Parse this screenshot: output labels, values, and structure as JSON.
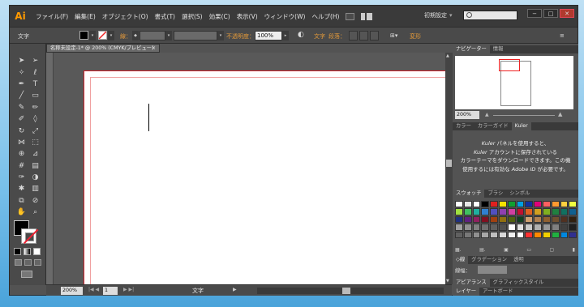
{
  "app": {
    "logo": "Ai"
  },
  "menu": [
    "ファイル(F)",
    "編集(E)",
    "オブジェクト(O)",
    "書式(T)",
    "選択(S)",
    "効果(C)",
    "表示(V)",
    "ウィンドウ(W)",
    "ヘルプ(H)"
  ],
  "workspace": {
    "label": "初期設定",
    "arrow": "▾"
  },
  "window_buttons": {
    "min": "−",
    "max": "□",
    "close": "✕"
  },
  "control": {
    "type_label": "文字",
    "stroke_label": "線：",
    "opacity_label": "不透明度：",
    "opacity_value": "100%",
    "char_label": "文字",
    "para_label": "段落：",
    "transform_label": "変形"
  },
  "document": {
    "tab_title": "名称未設定-1* @ 200% (CMYK/プレビュー)",
    "tab_close": "×"
  },
  "status": {
    "zoom": "200%",
    "page": "1",
    "tool": "文字"
  },
  "navigator": {
    "tabs": [
      "ナビゲーター",
      "情報"
    ],
    "zoom": "200%"
  },
  "color_tabs": [
    "カラー",
    "カラーガイド",
    "Kuler"
  ],
  "kuler": {
    "line1_em": "Kuler",
    "line1": " パネルを使用すると、",
    "line2_em": "Kuler",
    "line2": " アカウントに保存されている",
    "line3": "カラーテーマをダウンロードできます。この機",
    "line4a": "使用するには有効な ",
    "line4_em": "Adobe ID",
    "line4b": " が必要です。"
  },
  "swatch_tabs": [
    "スウォッチ",
    "ブラシ",
    "シンボル"
  ],
  "swatches": [
    "#ffffff",
    "#e8e8e8",
    "#ffffff",
    "#000000",
    "#e02020",
    "#f5e300",
    "#10a030",
    "#00a0e0",
    "#1030a0",
    "#e0007a",
    "#ff6060",
    "#ff9a30",
    "#ffd040",
    "#f0ff40",
    "#a0e040",
    "#40c060",
    "#20b0a0",
    "#3080d0",
    "#5050c0",
    "#9040b0",
    "#d040a0",
    "#c01030",
    "#e06020",
    "#d0a020",
    "#80b020",
    "#208040",
    "#107060",
    "#106090",
    "#203080",
    "#602080",
    "#902060",
    "#801020",
    "#a04010",
    "#907010",
    "#506010",
    "#104020",
    "#d0a070",
    "#b08050",
    "#906030",
    "#705030",
    "#503020",
    "#302010",
    "#a0a0a0",
    "#909090",
    "#808080",
    "#707070",
    "#606060",
    "#505050",
    "#ffffff",
    "#e0e0e0",
    "#c8c8c8",
    "#b0b0b0",
    "#989898",
    "#808080",
    "#404040",
    "#202020",
    "#606060",
    "#787878",
    "#909090",
    "#a8a8a8",
    "#c0c0c0",
    "#d8d8d8",
    "#f0f0f0",
    "#ffffff",
    "#ff3030",
    "#ff8800",
    "#f0d000",
    "#20b040",
    "#0088e0",
    "#303090"
  ],
  "stroke_panel": {
    "tabs": [
      "◇線",
      "グラデーション",
      "透明"
    ],
    "weight_label": "線幅："
  },
  "bottom_tabs": [
    "アピアランス",
    "グラフィックスタイル",
    "レイヤー",
    "アートボード"
  ],
  "tool_icons": [
    "selection-arrow-icon",
    "direct-select-icon",
    "magic-wand-icon",
    "lasso-icon",
    "pen-icon",
    "type-icon",
    "line-icon",
    "rectangle-icon",
    "paintbrush-icon",
    "pencil-icon",
    "blob-brush-icon",
    "eraser-icon",
    "rotate-icon",
    "scale-icon",
    "width-icon",
    "free-transform-icon",
    "shape-builder-icon",
    "perspective-icon",
    "mesh-icon",
    "gradient-icon",
    "eyedropper-icon",
    "blend-icon",
    "symbol-sprayer-icon",
    "graph-icon",
    "artboard-icon",
    "slice-icon",
    "hand-icon",
    "zoom-icon"
  ]
}
